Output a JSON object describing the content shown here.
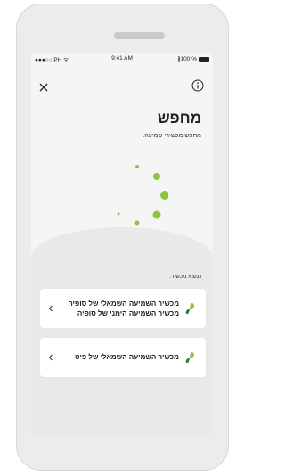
{
  "status_bar": {
    "carrier": "●●●○○ PH ᯤ",
    "time": "9:41 AM",
    "battery": "∦100 %"
  },
  "header": {
    "title": "מחפש",
    "subtitle": "מחפש מכשירי שמיעה."
  },
  "found_label": "נמצא מכשיר:",
  "devices": [
    {
      "line1": "מכשיר השמיעה השמאלי של סופיה",
      "line2": "מכשיר השמיעה הימני של סופיה"
    },
    {
      "line1": "מכשיר השמיעה השמאלי של פיט"
    }
  ],
  "colors": {
    "accent": "#8cc63f",
    "text": "#222222",
    "background": "#f5f5f6"
  },
  "icons": {
    "close": "close-icon",
    "info": "info-icon",
    "chevron": "chevron-left-icon",
    "hearing_aid": "hearing-aid-icon"
  }
}
